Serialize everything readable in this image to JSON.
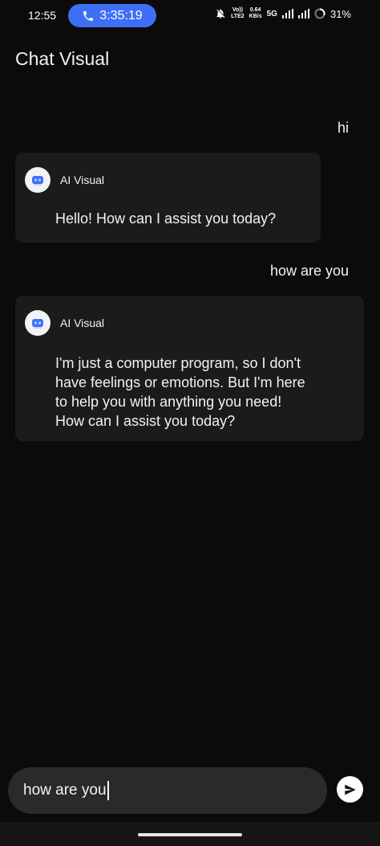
{
  "status_bar": {
    "time": "12:55",
    "call_timer": "3:35:19",
    "volte_label": "Vo))\nLTE2",
    "net_speed": "0.64\nKB/s",
    "network_type": "5G",
    "battery": "31%",
    "icons": {
      "call": "phone-icon",
      "mute": "bell-off-icon",
      "signal1": "signal-icon",
      "signal2": "signal-icon",
      "battery": "battery-ring-icon"
    },
    "accent_color": "#3f6ef6"
  },
  "header": {
    "title": "Chat Visual"
  },
  "messages": [
    {
      "role": "user",
      "text": "hi"
    },
    {
      "role": "ai",
      "name": "AI Visual",
      "text": "Hello! How can I assist you today?"
    },
    {
      "role": "user",
      "text": "how are you"
    },
    {
      "role": "ai",
      "name": "AI Visual",
      "text": "I'm just a computer program, so I don't\nhave feelings or emotions. But I'm here\nto help you with anything you need!\nHow can I assist you today?"
    }
  ],
  "composer": {
    "value": "how are you",
    "send_icon": "send-icon"
  }
}
